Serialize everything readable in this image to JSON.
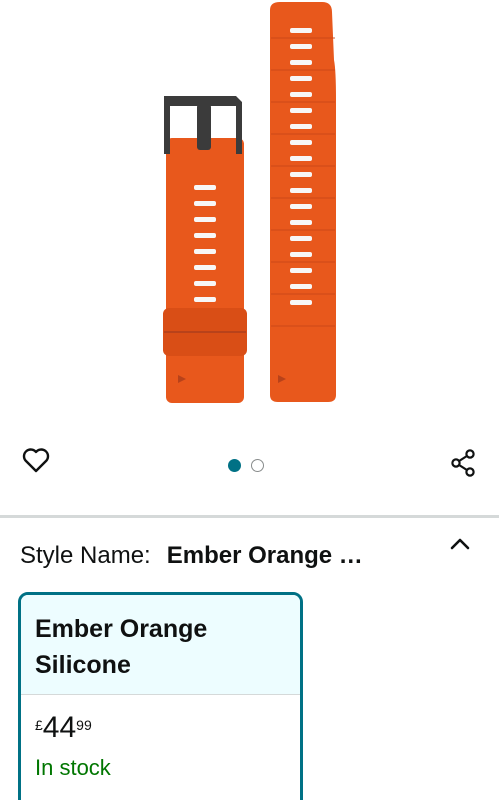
{
  "product": {
    "image": {
      "icon": "watch-strap-image",
      "strap_color": "#e8581c",
      "buckle_color": "#3b3b3b"
    },
    "carousel": {
      "total": 2,
      "active_index": 1
    },
    "icons": {
      "wishlist": "heart-icon",
      "share": "share-icon",
      "collapse": "chevron-up-icon"
    }
  },
  "style_selector": {
    "label": "Style Name:",
    "selected_value": "Ember Orange …"
  },
  "variant": {
    "name": "Ember Orange Silicone",
    "price": {
      "currency": "£",
      "whole": "44",
      "fraction": "99"
    },
    "availability": "In stock"
  },
  "colors": {
    "accent": "#007185",
    "selected_bg": "#edfdff",
    "in_stock": "#007600"
  }
}
